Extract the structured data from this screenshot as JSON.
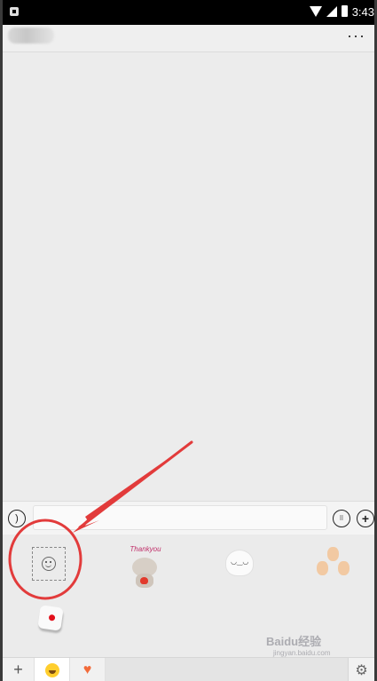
{
  "status_bar": {
    "time": "3:43",
    "icons": [
      "notification-icon",
      "wifi-icon",
      "signal-icon",
      "battery-icon"
    ]
  },
  "title_bar": {
    "contact_name": "",
    "more_label": "···"
  },
  "input_bar": {
    "voice_icon": "voice-icon",
    "text_value": "",
    "keyboard_icon": "keyboard-icon",
    "plus_label": "+"
  },
  "sticker_panel": {
    "stickers": [
      {
        "name": "add-custom-sticker",
        "icon": "smile-plus-icon"
      },
      {
        "name": "thank-you-bear",
        "caption": "Thankyou"
      },
      {
        "name": "ghost-sticker"
      },
      {
        "name": "rock-paper-scissors"
      },
      {
        "name": "dice"
      }
    ]
  },
  "tab_bar": {
    "add_label": "+",
    "tabs": [
      {
        "name": "emoji-tab",
        "icon": "emoji-icon",
        "selected": true
      },
      {
        "name": "favorites-tab",
        "icon": "heart-icon",
        "selected": false
      }
    ],
    "settings_icon": "gear-icon"
  },
  "annotation": {
    "color": "#e23b3b",
    "target": "add-custom-sticker"
  },
  "watermark": {
    "title": "Baidu经验",
    "subtitle": "jingyan.baidu.com"
  },
  "colors": {
    "background": "#ececec",
    "status_bar": "#000000",
    "annotation_red": "#e23b3b",
    "heart": "#f26b3a",
    "emoji_yellow": "#ffce2e"
  }
}
